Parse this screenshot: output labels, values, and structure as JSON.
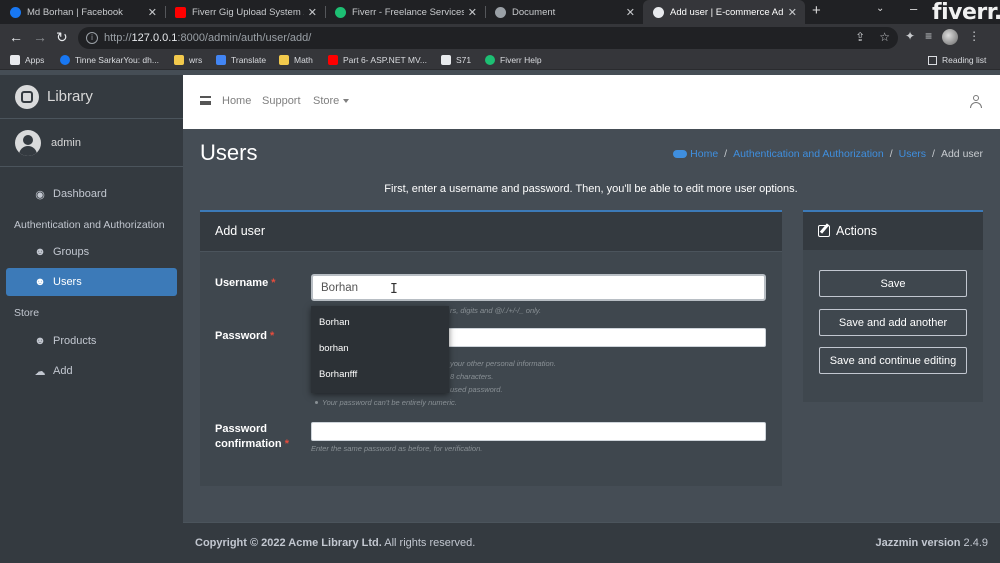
{
  "browser": {
    "tabs": [
      {
        "title": "Md Borhan | Facebook",
        "icon_color": "#1877f2"
      },
      {
        "title": "Fiverr Gig Upload System 20...",
        "icon_color": "#ff0000"
      },
      {
        "title": "Fiverr - Freelance Services M...",
        "icon_color": "#1dbf73"
      },
      {
        "title": "Document",
        "icon_color": "#9aa0a6"
      },
      {
        "title": "Add user | E-commerce Adm...",
        "icon_color": "#e8eaed"
      }
    ],
    "close_glyph": "✕",
    "new_tab_glyph": "+",
    "url": {
      "prefix": "http://",
      "host": "127.0.0.1",
      "path": ":8000/admin/auth/user/add/"
    },
    "bookmarks": [
      {
        "label": "Apps",
        "icon_color": "#e8eaed"
      },
      {
        "label": "Tinne SarkarYou: dh...",
        "icon_color": "#1877f2"
      },
      {
        "label": "wrs",
        "icon_color": "#f2c94c"
      },
      {
        "label": "Translate",
        "icon_color": "#4285f4"
      },
      {
        "label": "Math",
        "icon_color": "#f2c94c"
      },
      {
        "label": "Part 6- ASP.NET MV...",
        "icon_color": "#ff0000"
      },
      {
        "label": "S71",
        "icon_color": "#e8eaed"
      },
      {
        "label": "Fiverr Help",
        "icon_color": "#1dbf73"
      }
    ],
    "reading_list": "Reading list",
    "watermark": "fiverr."
  },
  "sidebar": {
    "brand": "Library",
    "user": "admin",
    "items": [
      {
        "label": "Dashboard",
        "icon": "tachometer-icon",
        "glyph": "◉"
      },
      {
        "label": "Groups",
        "icon": "users-icon",
        "glyph": "☻"
      },
      {
        "label": "Users",
        "icon": "user-icon",
        "glyph": "☻"
      },
      {
        "label": "Products",
        "icon": "user-icon",
        "glyph": "☻"
      },
      {
        "label": "Add",
        "icon": "comments-icon",
        "glyph": "☁"
      }
    ],
    "headers": [
      "Authentication and Authorization",
      "Store"
    ],
    "active_item": "Users"
  },
  "topnav": {
    "home": "Home",
    "support": "Support",
    "store": "Store"
  },
  "page": {
    "title": "Users",
    "breadcrumb": [
      "Home",
      "Authentication and Authorization",
      "Users",
      "Add user"
    ],
    "breadcrumb_sep": "/",
    "intro": "First, enter a username and password. Then, you'll be able to edit more user options."
  },
  "form": {
    "header": "Add user",
    "username_label": "Username",
    "username_value": "Borhan",
    "username_help": "rs, digits and @/./+/-/_ only.",
    "password_label": "Password",
    "password_help": [
      "your other personal information.",
      "8 characters.",
      "used password.",
      "Your password can't be entirely numeric."
    ],
    "confirm_label": "Password confirmation",
    "confirm_help": "Enter the same password as before, for verification.",
    "required_mark": "*"
  },
  "autocomplete": [
    "Borhan",
    "borhan",
    "Borhanfff"
  ],
  "actions": {
    "header": "Actions",
    "buttons": [
      "Save",
      "Save and add another",
      "Save and continue editing"
    ]
  },
  "footer": {
    "copyright_prefix": "Copyright © 2022 Acme Library Ltd.",
    "copyright_suffix": " All rights reserved.",
    "version_label": "Jazzmin version",
    "version": "2.4.9"
  },
  "colors": {
    "accent": "#3c7ab8",
    "link": "#3f8fdf",
    "required": "#e74c3c"
  }
}
